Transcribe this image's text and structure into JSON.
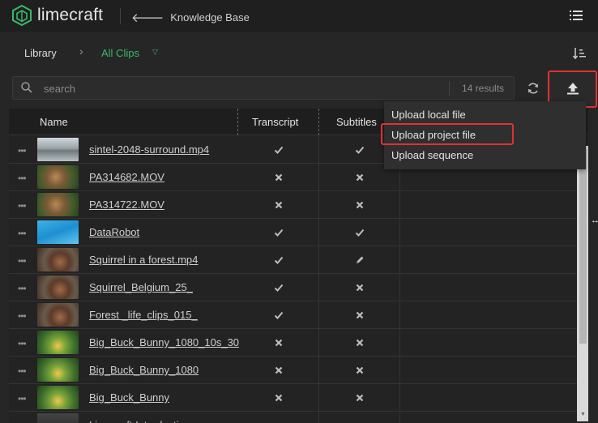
{
  "app": {
    "name": "limecraft",
    "brand_color": "#3bb86a"
  },
  "header": {
    "back_label": "Knowledge Base"
  },
  "breadcrumb": {
    "library": "Library",
    "current": "All Clips"
  },
  "search": {
    "placeholder": "search",
    "results": "14 results"
  },
  "table": {
    "columns": [
      "Name",
      "Transcript",
      "Subtitles"
    ],
    "rows": [
      {
        "name": "sintel-2048-surround.mp4",
        "transcript": "check",
        "subtitles": "check",
        "thumb": "snow"
      },
      {
        "name": "PA314682.MOV",
        "transcript": "cross",
        "subtitles": "cross",
        "thumb": "animal"
      },
      {
        "name": "PA314722.MOV",
        "transcript": "cross",
        "subtitles": "cross",
        "thumb": "animal"
      },
      {
        "name": "DataRobot",
        "transcript": "check",
        "subtitles": "check",
        "thumb": "blue"
      },
      {
        "name": "Squirrel in a forest.mp4",
        "transcript": "check",
        "subtitles": "pencil",
        "thumb": "squirrel"
      },
      {
        "name": "Squirrel_Belgium_25_",
        "transcript": "check",
        "subtitles": "cross",
        "thumb": "squirrel"
      },
      {
        "name": "Forest _life_clips_015_",
        "transcript": "check",
        "subtitles": "cross",
        "thumb": "squirrel"
      },
      {
        "name": "Big_Buck_Bunny_1080_10s_30",
        "transcript": "cross",
        "subtitles": "cross",
        "thumb": "green"
      },
      {
        "name": "Big_Buck_Bunny_1080",
        "transcript": "cross",
        "subtitles": "cross",
        "thumb": "green"
      },
      {
        "name": "Big_Buck_Bunny",
        "transcript": "cross",
        "subtitles": "cross",
        "thumb": "green"
      },
      {
        "name": "Limecraft Introduction",
        "transcript": "",
        "subtitles": "",
        "thumb": "dark"
      }
    ]
  },
  "upload_menu": {
    "items": [
      "Upload local file",
      "Upload project file",
      "Upload sequence"
    ]
  }
}
